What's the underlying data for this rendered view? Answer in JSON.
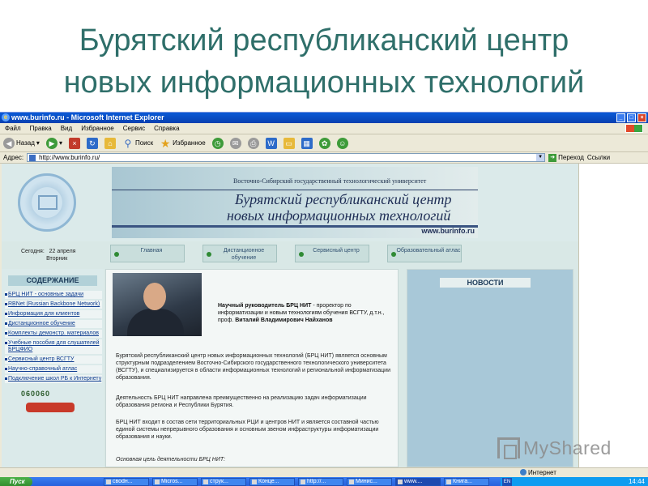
{
  "slide": {
    "title_line1": "Бурятский республиканский центр",
    "title_line2": "новых информационных технологий"
  },
  "window": {
    "title": "www.burinfo.ru - Microsoft Internet Explorer"
  },
  "menu": [
    "Файл",
    "Правка",
    "Вид",
    "Избранное",
    "Сервис",
    "Справка"
  ],
  "toolbar": {
    "back": "Назад",
    "search": "Поиск",
    "favorites": "Избранное"
  },
  "address": {
    "label": "Адрес:",
    "url": "http://www.burinfo.ru/",
    "go": "Переход",
    "links": "Ссылки"
  },
  "site": {
    "university": "Восточно-Сибирский государственный технологический университет",
    "name_line1": "Бурятский республиканский центр",
    "name_line2": "новых информационных технологий",
    "domain": "www.burinfo.ru",
    "today_label": "Сегодня:",
    "today_date": "22 апреля",
    "today_weekday": "Вторник",
    "nav": [
      "Главная",
      "Дистанционное обучение",
      "Сервисный центр",
      "Образовательный атлас"
    ],
    "contents_title": "СОДЕРЖАНИЕ",
    "side_items": [
      "БРЦ НИТ - основные задачи",
      "RBNet (Russian Backbone Network)",
      "Информация для клиентов",
      "Дистанционное обучение",
      "Комплекты демонстр. материалов",
      "Учебные пособия для слушателей БРЦФИО",
      "Сервисный центр ВСГТУ",
      "Научно-справочный атлас",
      "Подключение школ РБ к Интернету"
    ],
    "counter": "060060",
    "director_bold": "Научный руководитель БРЦ НИТ",
    "director_text": " - проректор по информатизации и новым технологиям обучения ВСГТУ, д.т.н., проф. ",
    "director_name": "Виталий Владимирович Найханов",
    "para1": "Бурятский республиканский центр новых информационных технологий (БРЦ НИТ) является основным структурным подразделением Восточно-Сибирского государственного технологического университета (ВСГТУ), и специализируется в области информационных технологий и региональной информатизации образования.",
    "para2": "Деятельность БРЦ НИТ направлена преимущественно на реализацию задач информатизации образования региона и Республики Бурятия.",
    "para3": "БРЦ НИТ входит в состав сети территориальных РЦИ и центров НИТ и является составной частью единой системы непрерывного образования и основным звеном инфраструктуры информатизации образования и науки.",
    "para4": "Основная цель деятельности БРЦ НИТ:",
    "news_title": "НОВОСТИ"
  },
  "status": {
    "zone": "Интернет"
  },
  "taskbar": {
    "start": "Пуск",
    "tasks": [
      "своdн...",
      "Micros...",
      "струк...",
      "Конце...",
      "http://...",
      "Минис...",
      "www....",
      "Книга..."
    ],
    "lang": "EN",
    "clock": "14:44"
  },
  "watermark": "MyShared",
  "colors": {
    "title_text": "#2f6f6a",
    "xp_blue": "#0a5ad6",
    "start_green": "#2f8b2c",
    "page_bg": "#d9e8e6"
  }
}
